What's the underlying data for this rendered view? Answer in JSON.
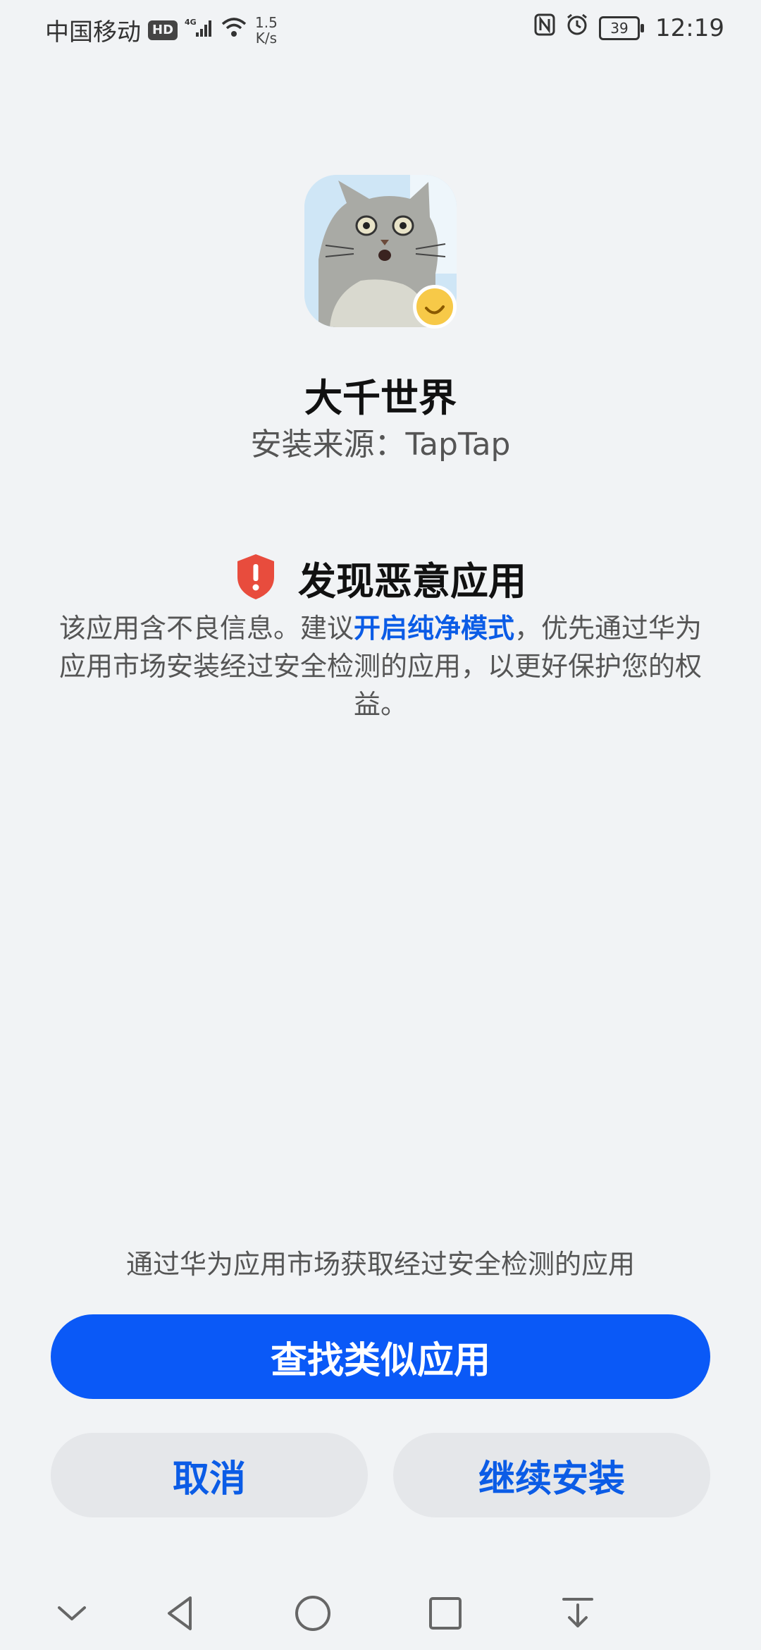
{
  "status_bar": {
    "carrier": "中国移动",
    "hd": "HD",
    "network": "4G",
    "speed_value": "1.5",
    "speed_unit": "K/s",
    "battery": "39",
    "time": "12:19"
  },
  "app": {
    "name": "大千世界",
    "source": "安装来源：TapTap"
  },
  "warning": {
    "title": "发现恶意应用",
    "body_prefix": "该应用含不良信息。建议",
    "body_link": "开启纯净模式",
    "body_suffix": "，优先通过华为应用市场安装经过安全检测的应用，以更好保护您的权益。"
  },
  "bottom": {
    "hint": "通过华为应用市场获取经过安全检测的应用",
    "primary_button": "查找类似应用",
    "cancel_button": "取消",
    "continue_button": "继续安装"
  },
  "colors": {
    "background": "#f1f3f5",
    "accent": "#0a59f7",
    "danger": "#e84c3d",
    "secondary_button": "#e5e7ea"
  },
  "icons": [
    "nfc-icon",
    "alarm-icon",
    "battery-icon",
    "wifi-icon",
    "signal-icon",
    "shield-alert-icon",
    "chevron-down-icon",
    "back-icon",
    "home-icon",
    "recents-icon",
    "notification-down-icon"
  ]
}
